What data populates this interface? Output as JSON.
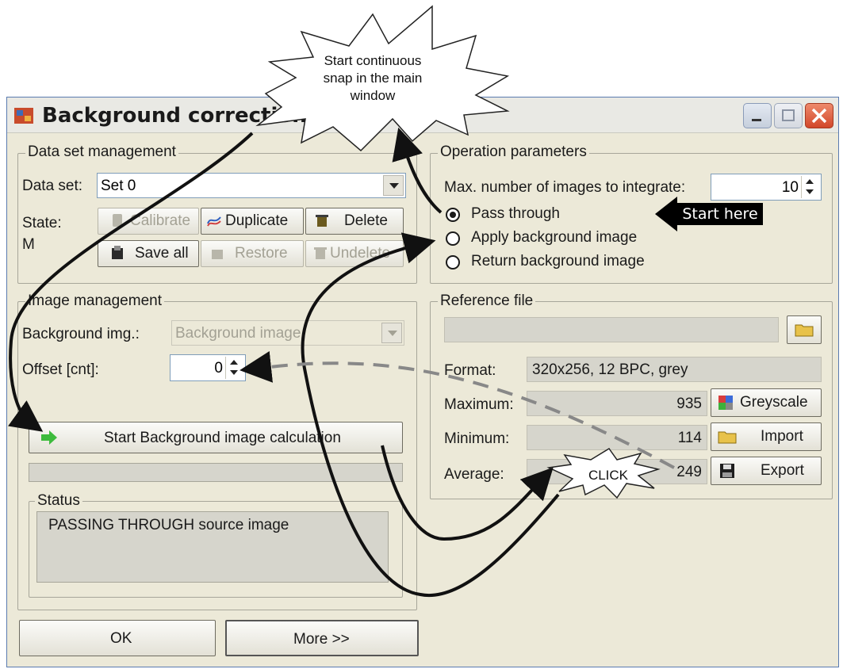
{
  "window": {
    "title": "Background correction"
  },
  "annotations": {
    "callout_top": "Start continuous\nsnap in the main\nwindow",
    "start_here": "Start here",
    "click": "CLICK"
  },
  "dataset": {
    "legend": "Data set management",
    "label": "Data set:",
    "value": "Set 0",
    "state_label": "State:",
    "state_value": "M",
    "buttons": {
      "calibrate": "Calibrate",
      "duplicate": "Duplicate",
      "delete": "Delete",
      "save_all": "Save all",
      "restore": "Restore",
      "undelete": "Undelete"
    }
  },
  "image_mgmt": {
    "legend": "Image management",
    "bg_label": "Background img.:",
    "bg_value": "Background image",
    "offset_label": "Offset [cnt]:",
    "offset_value": "0",
    "start_button": "Start Background image calculation"
  },
  "status": {
    "legend": "Status",
    "text": "PASSING THROUGH source image"
  },
  "footer": {
    "ok": "OK",
    "more": "More >>"
  },
  "operation": {
    "legend": "Operation parameters",
    "max_label": "Max. number of images to integrate:",
    "max_value": "10",
    "options": [
      "Pass through",
      "Apply background image",
      "Return background image"
    ],
    "selected": "Pass through"
  },
  "reference": {
    "legend": "Reference file",
    "format_label": "Format:",
    "format_value": "320x256, 12 BPC, grey",
    "maximum_label": "Maximum:",
    "maximum_value": "935",
    "minimum_label": "Minimum:",
    "minimum_value": "114",
    "average_label": "Average:",
    "average_value": "249",
    "greyscale": "Greyscale",
    "import": "Import",
    "export": "Export"
  },
  "colors": {
    "face": "#ece9d8",
    "title_text": "#1a1a1a",
    "close": "#d2472a",
    "disabled": "#a3a194"
  }
}
